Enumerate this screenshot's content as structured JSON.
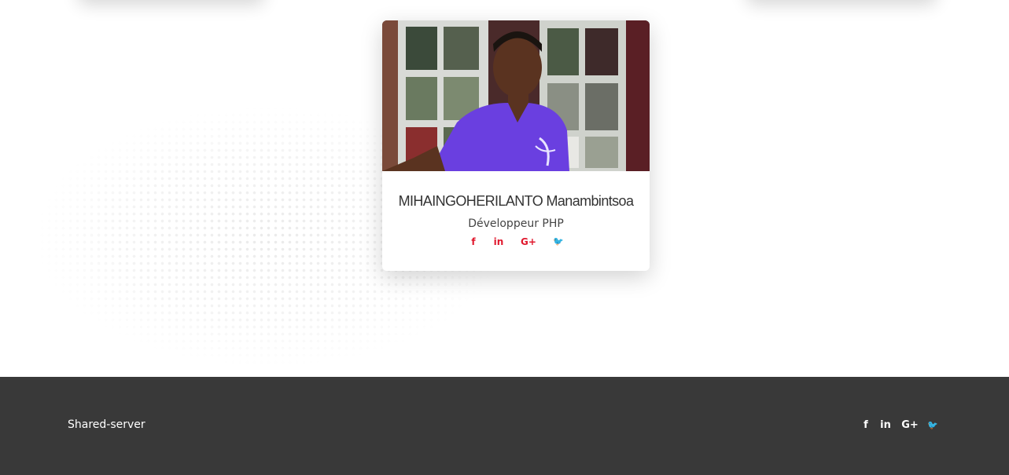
{
  "team_member": {
    "name": "MIHAINGOHERILANTO Manambintsoa",
    "role": "Développeur PHP",
    "social": [
      {
        "icon": "facebook-icon",
        "glyph": "f"
      },
      {
        "icon": "linkedin-icon",
        "glyph": "in"
      },
      {
        "icon": "google-plus-icon",
        "glyph": "G+"
      },
      {
        "icon": "twitter-icon",
        "glyph": "🐦"
      }
    ]
  },
  "footer": {
    "brand": "Shared-server",
    "social": [
      {
        "icon": "facebook-icon",
        "glyph": "f"
      },
      {
        "icon": "linkedin-icon",
        "glyph": "in"
      },
      {
        "icon": "google-plus-icon",
        "glyph": "G+"
      },
      {
        "icon": "twitter-icon",
        "glyph": "🐦"
      }
    ]
  },
  "colors": {
    "accent": "#e0182d",
    "footer_bg": "#393939",
    "footer_text": "#ffffff"
  }
}
